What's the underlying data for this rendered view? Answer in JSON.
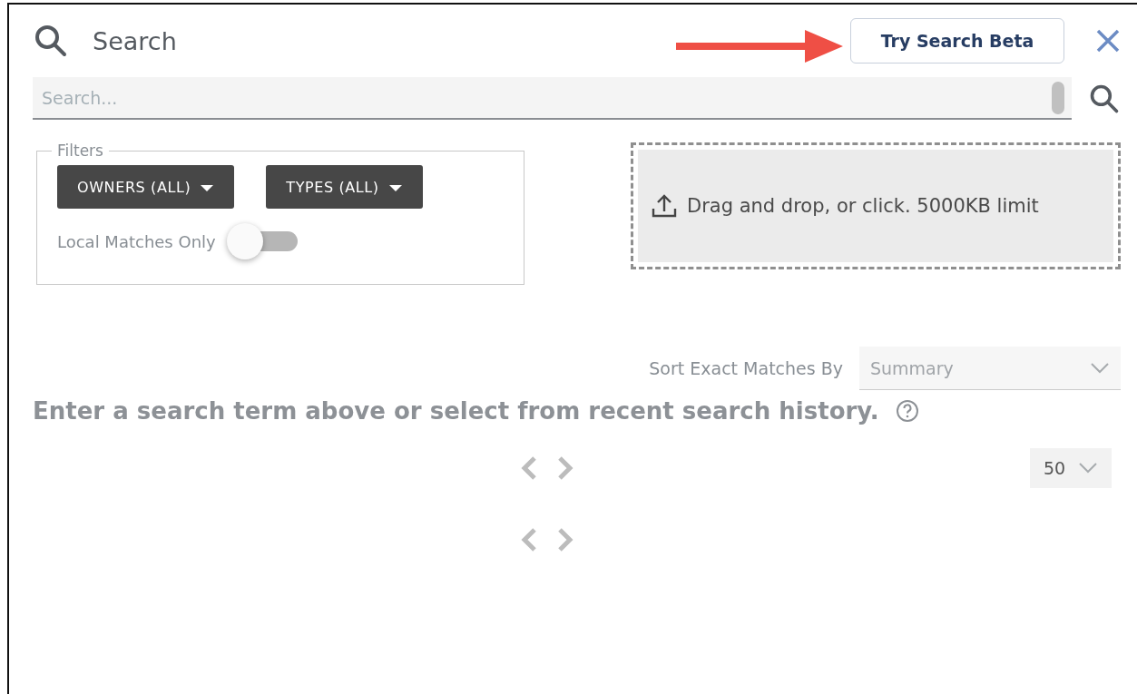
{
  "header": {
    "title": "Search",
    "beta_button": "Try Search Beta"
  },
  "search": {
    "placeholder": "Search..."
  },
  "filters": {
    "legend": "Filters",
    "dropdowns": [
      "OWNERS (ALL)",
      "TYPES (ALL)"
    ],
    "local_toggle": {
      "label": "Local Matches Only",
      "on": false
    }
  },
  "upload": {
    "text": "Drag and drop, or click. 5000KB limit"
  },
  "sort": {
    "label": "Sort Exact Matches By",
    "value": "Summary"
  },
  "message": "Enter a search term above or select from recent search history.",
  "page_size": "50",
  "pagers": [
    {
      "prev_disabled": true,
      "next_disabled": true
    },
    {
      "prev_disabled": true,
      "next_disabled": true
    }
  ]
}
